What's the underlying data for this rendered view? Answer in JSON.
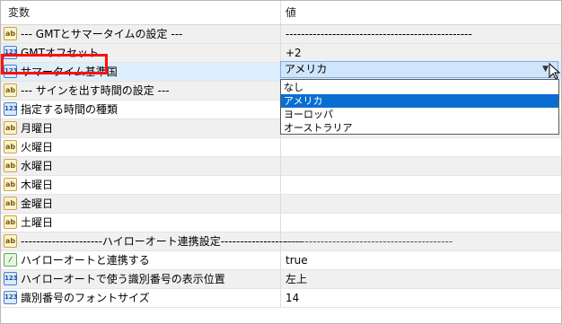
{
  "header": {
    "var_label": "変数",
    "val_label": "値"
  },
  "rows": [
    {
      "name": "--- GMTとサマータイムの設定 ---",
      "value": "------------------------------------------------",
      "icon": "ab"
    },
    {
      "name": "GMTオフセット",
      "value": "+2",
      "icon": "123"
    },
    {
      "name": "サマータイム基準国",
      "value": "アメリカ",
      "icon": "123"
    },
    {
      "name": "--- サインを出す時間の設定 ---",
      "value": "",
      "icon": "ab"
    },
    {
      "name": "指定する時間の種類",
      "value": "",
      "icon": "123"
    },
    {
      "name": "月曜日",
      "value": "",
      "icon": "ab"
    },
    {
      "name": "火曜日",
      "value": "",
      "icon": "ab"
    },
    {
      "name": "水曜日",
      "value": "",
      "icon": "ab"
    },
    {
      "name": "木曜日",
      "value": "",
      "icon": "ab"
    },
    {
      "name": "金曜日",
      "value": "",
      "icon": "ab"
    },
    {
      "name": "土曜日",
      "value": "",
      "icon": "ab"
    },
    {
      "name": "---------------------ハイローオート連携設定---------------------",
      "value": "-------------------------------------------",
      "icon": "ab"
    },
    {
      "name": "ハイローオートと連携する",
      "value": "true",
      "icon": "bool"
    },
    {
      "name": "ハイローオートで使う識別番号の表示位置",
      "value": "左上",
      "icon": "123"
    },
    {
      "name": "識別番号のフォントサイズ",
      "value": "14",
      "icon": "123"
    }
  ],
  "combo": {
    "selected": "アメリカ",
    "arrow": "▼"
  },
  "dropdown": {
    "options": [
      "なし",
      "アメリカ",
      "ヨーロッパ",
      "オーストラリア"
    ],
    "selected_index": 1
  },
  "icons": {
    "text_icon": "ab",
    "number_icon": "123",
    "bool_icon": "⁄"
  }
}
